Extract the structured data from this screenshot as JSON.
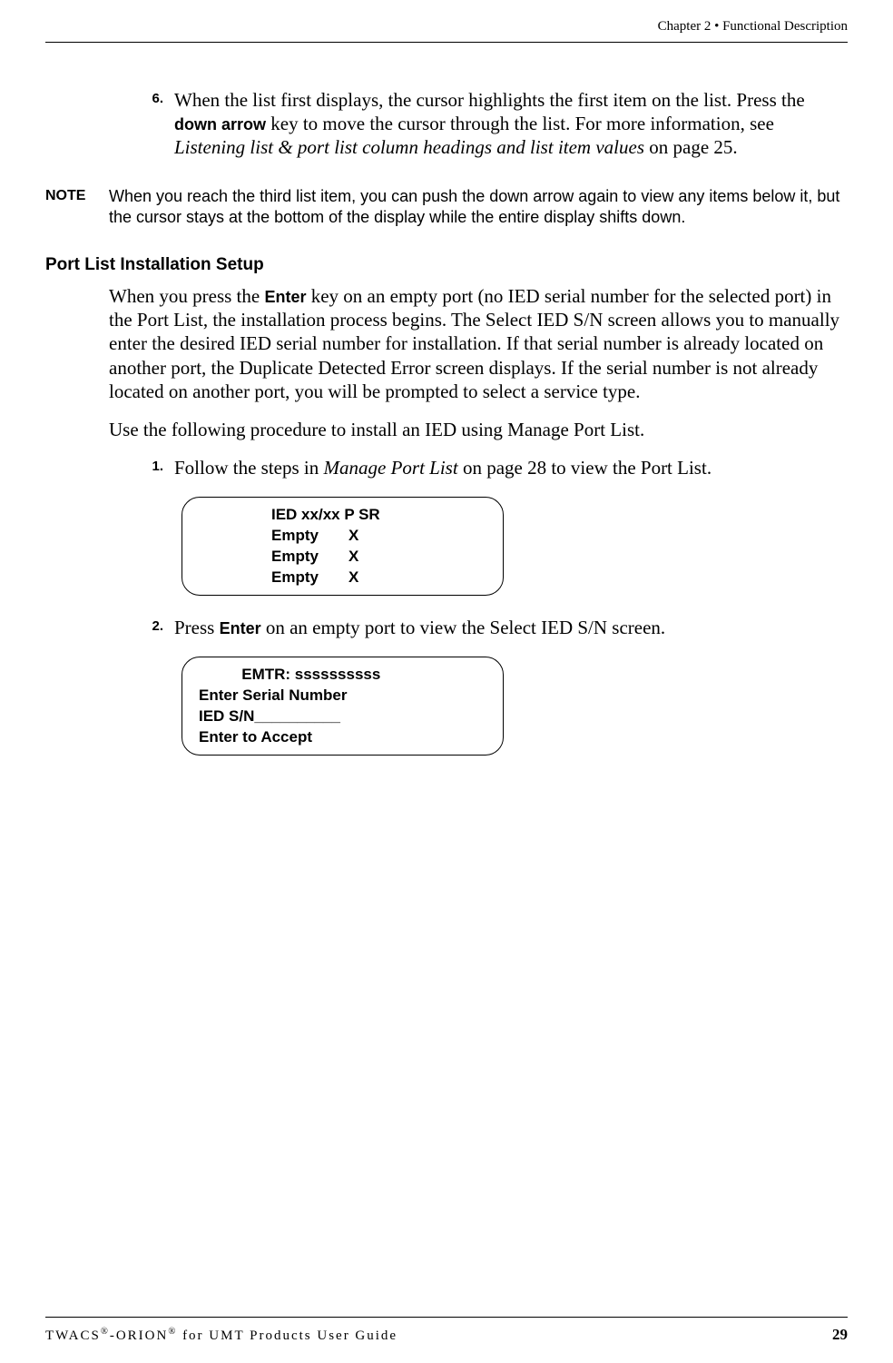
{
  "header": {
    "chapter": "Chapter 2 • Functional Description"
  },
  "step6": {
    "num": "6.",
    "text_pre": "When the list first displays, the cursor highlights the first item on the list. Press the ",
    "bold1": "down arrow",
    "text_mid1": " key to move the cursor through the list. For more information, see ",
    "italic1": "Listening list & port list column headings and list item values",
    "text_end": " on page 25."
  },
  "note": {
    "label": "NOTE",
    "body": "When you reach the third list item, you can push the down arrow again to view any items below it, but the cursor stays at the bottom of the display while the entire display shifts down."
  },
  "section_heading": "Port List Installation Setup",
  "para1": {
    "pre": "When you press the ",
    "bold": "Enter",
    "post": " key on an empty port (no IED serial number for the selected port) in the Port List, the installation process begins. The Select IED S/N screen allows you to manually enter the desired IED serial number for installation. If that serial number is already located on another port, the Duplicate Detected Error screen displays. If the serial number is not already located on another port, you will be prompted to select a service type."
  },
  "para2": "Use the following procedure to install an IED using Manage Port List.",
  "step1": {
    "num": "1.",
    "pre": "Follow the steps in ",
    "italic": "Manage Port List",
    "post": " on page 28 to view the Port List."
  },
  "screen1": {
    "line1": "IED xx/xx P SR",
    "line2": "Empty       X",
    "line3": "Empty       X",
    "line4": "Empty       X"
  },
  "step2": {
    "num": "2.",
    "pre": "Press ",
    "bold": "Enter",
    "post": " on an empty port to view the Select IED S/N screen."
  },
  "screen2": {
    "line1": "          EMTR: ssssssssss",
    "line2": "Enter Serial Number",
    "line3": "IED S/N__________",
    "line4": "Enter to Accept"
  },
  "footer": {
    "left_html": "TWACS®-ORION® for UMT Products User Guide",
    "page": "29"
  }
}
